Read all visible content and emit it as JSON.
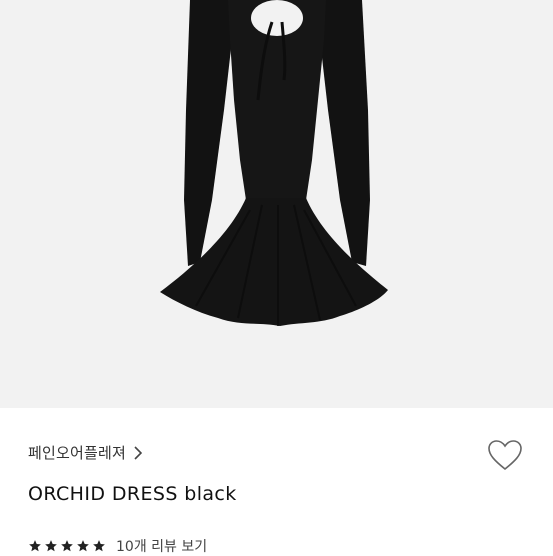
{
  "product": {
    "brand": "페인오어플레져",
    "title": "ORCHID DRESS black",
    "rating_stars": 5,
    "review_link": "10개 리뷰 보기",
    "image_alt_icon": "dress-image"
  },
  "colors": {
    "image_bg": "#f2f2f2",
    "dress": "#121212",
    "star": "#222222",
    "heart_outline": "#666666"
  },
  "icons": {
    "brand_chevron": "chevron-right-icon",
    "like": "heart-outline-icon",
    "star": "star-filled-icon"
  }
}
